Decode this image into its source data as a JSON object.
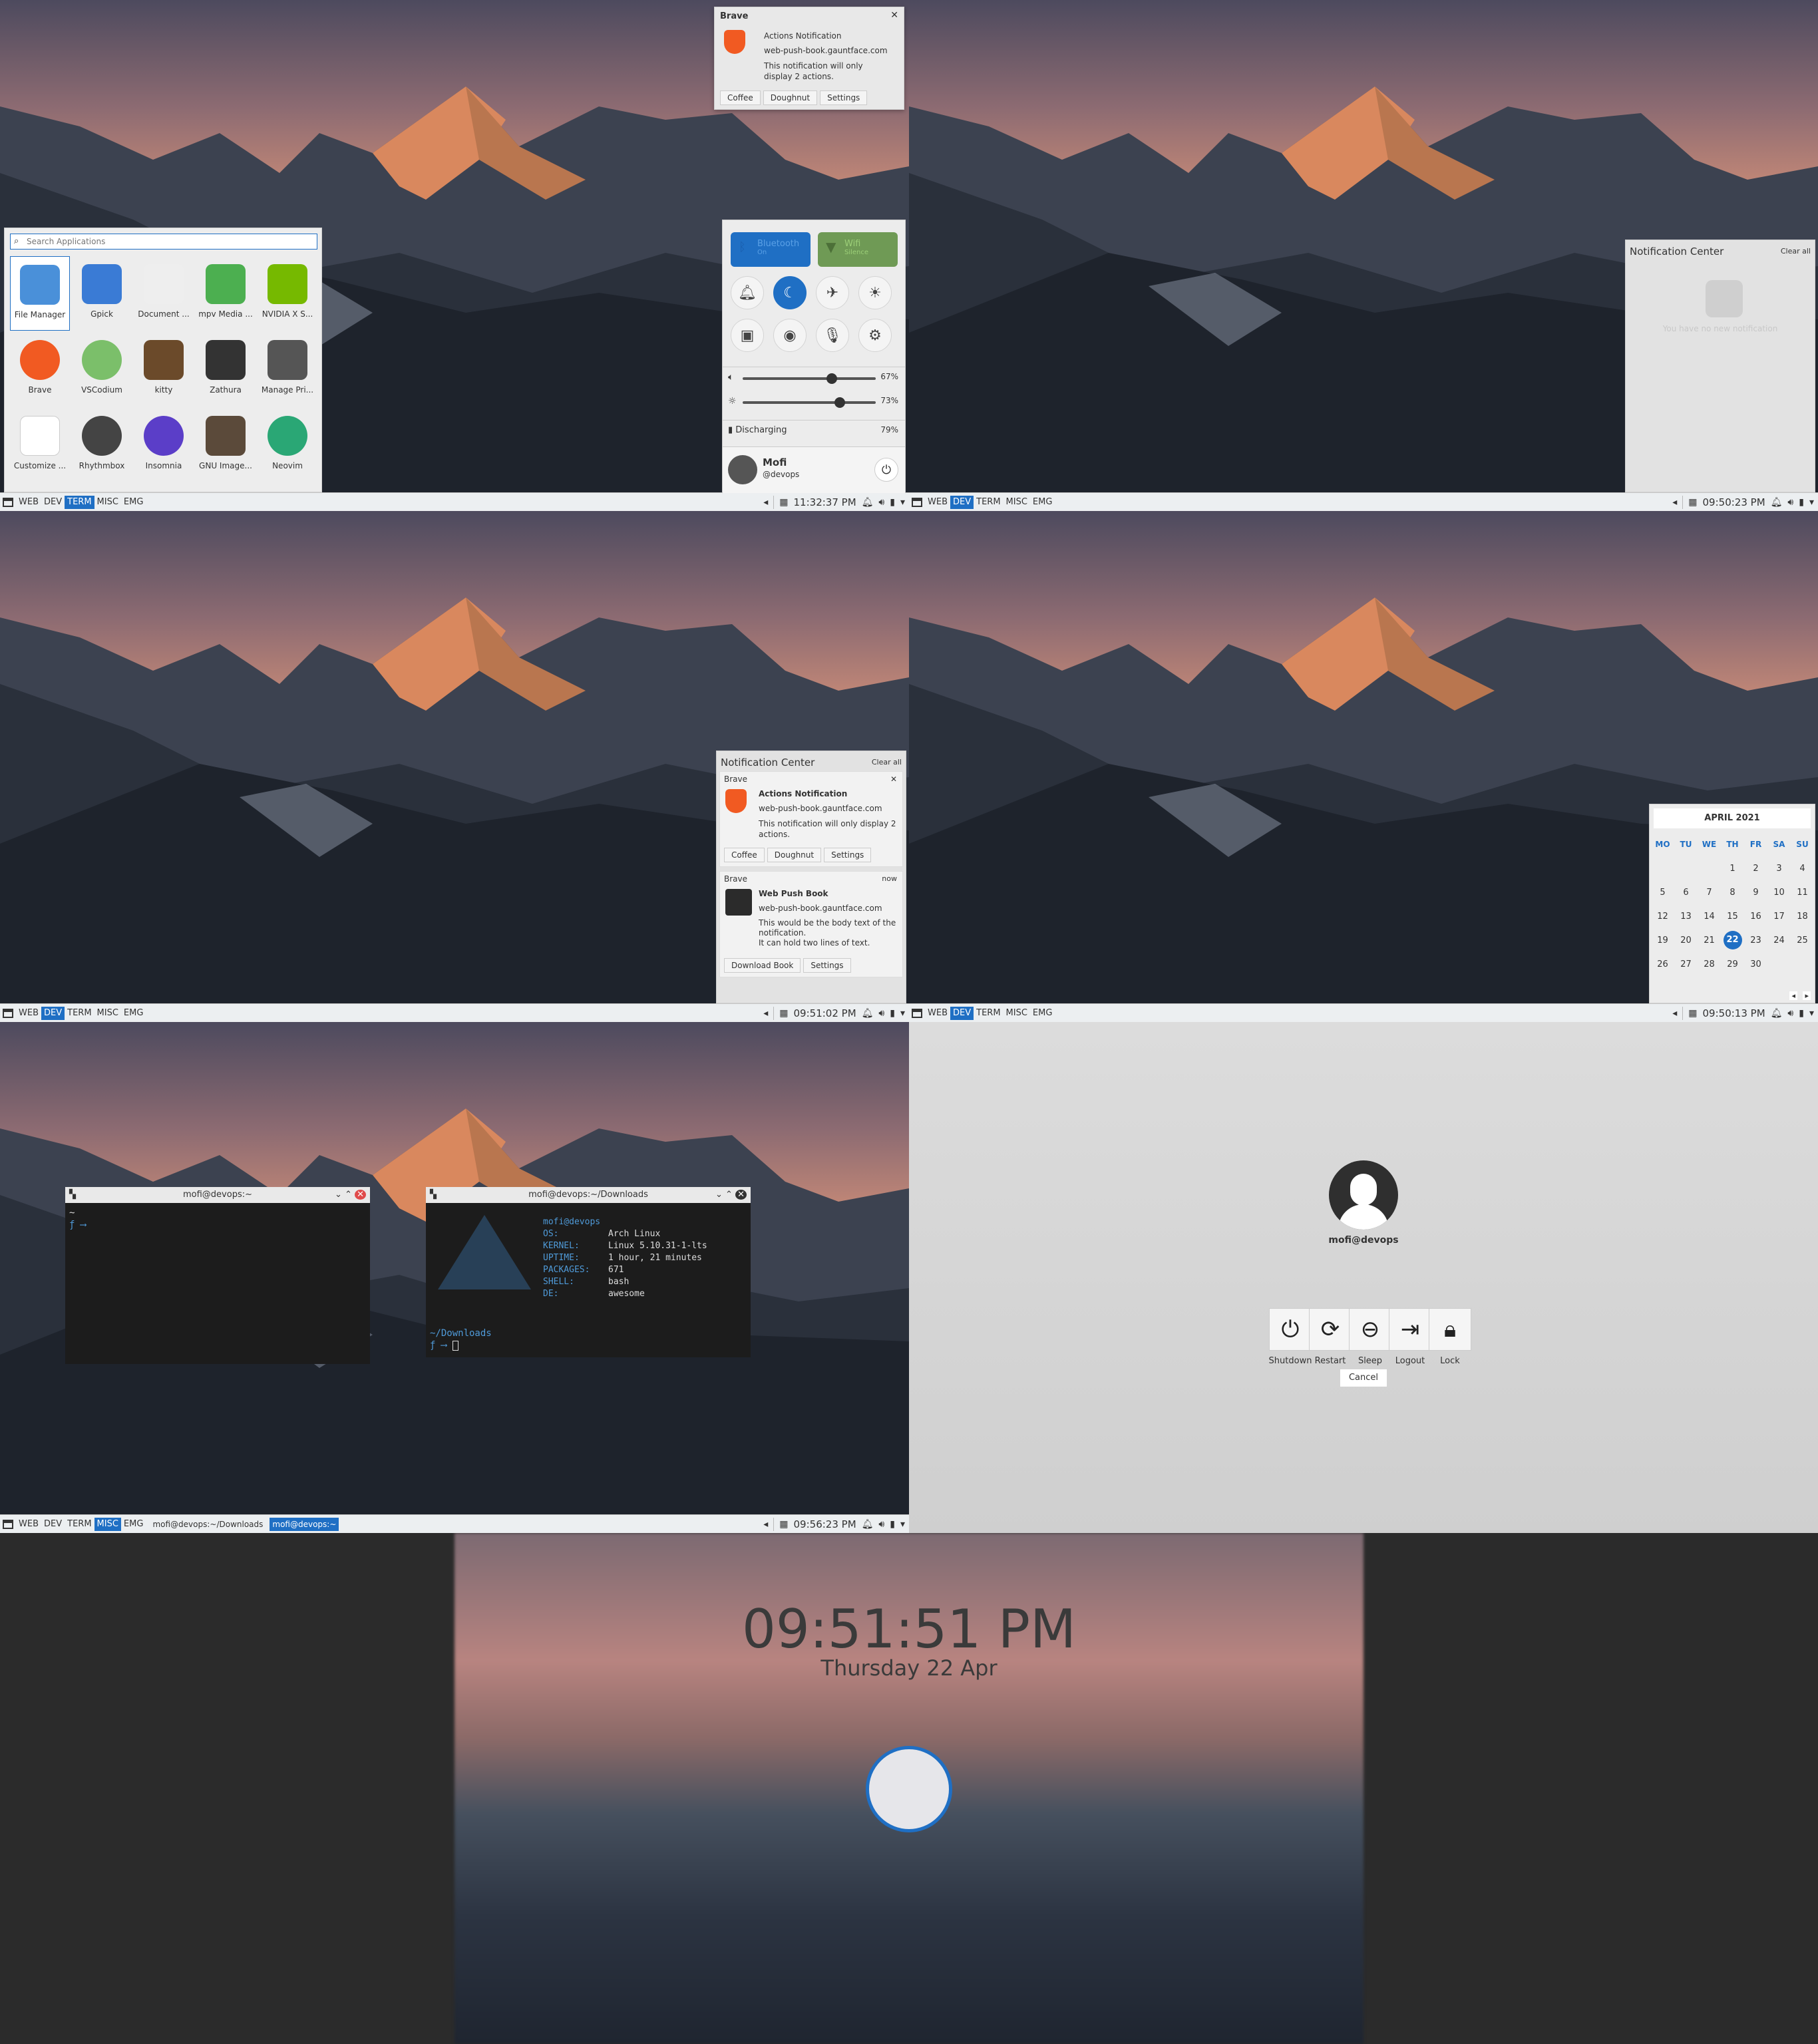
{
  "taskbar_tags": [
    "WEB",
    "DEV",
    "TERM",
    "MISC",
    "EMG"
  ],
  "panel1": {
    "clock": "11:32:37 PM",
    "notification": {
      "app": "Brave",
      "title": "Actions Notification",
      "site": "web-push-book.gauntface.com",
      "body": "This notification will only display 2 actions.",
      "actions": [
        "Coffee",
        "Doughnut",
        "Settings"
      ]
    },
    "launcher": {
      "search_placeholder": "Search Applications",
      "apps": [
        "File Manager",
        "Gpick",
        "Document ...",
        "mpv Media ...",
        "NVIDIA X S...",
        "Brave",
        "VSCodium",
        "kitty",
        "Zathura",
        "Manage Pri...",
        "Customize ...",
        "Rhythmbox",
        "Insomnia",
        "GNU Image...",
        "Neovim"
      ]
    },
    "quick": {
      "bluetooth": "Bluetooth",
      "bluetooth_sub": "On",
      "wifi": "Wifi",
      "wifi_sub": "Silence",
      "volume": "67%",
      "volume_value": 0.67,
      "brightness": "73%",
      "brightness_value": 0.73,
      "battery": "Discharging",
      "battery_pct": "79%",
      "user": "Mofi",
      "handle": "@devops"
    }
  },
  "panel2": {
    "clock": "09:50:23 PM",
    "title": "Notification Center",
    "clear": "Clear all",
    "empty": "You have no new notification"
  },
  "panel3": {
    "clock": "09:51:02 PM",
    "title": "Notification Center",
    "clear": "Clear all",
    "n1": {
      "app": "Brave",
      "title": "Actions Notification",
      "site": "web-push-book.gauntface.com",
      "body": "This notification will only display 2 actions.",
      "actions": [
        "Coffee",
        "Doughnut",
        "Settings"
      ]
    },
    "n2": {
      "app": "Brave",
      "time": "now",
      "title": "Web Push Book",
      "site": "web-push-book.gauntface.com",
      "body1": "This would be the body text of the notification.",
      "body2": "It can hold two lines of text.",
      "actions": [
        "Download Book",
        "Settings"
      ]
    }
  },
  "panel4": {
    "clock": "09:50:13 PM",
    "month": "APRIL 2021",
    "days": [
      "MO",
      "TU",
      "WE",
      "TH",
      "FR",
      "SA",
      "SU"
    ],
    "weeks": [
      [
        "",
        "",
        "",
        "1",
        "2",
        "3",
        "4"
      ],
      [
        "5",
        "6",
        "7",
        "8",
        "9",
        "10",
        "11"
      ],
      [
        "12",
        "13",
        "14",
        "15",
        "16",
        "17",
        "18"
      ],
      [
        "19",
        "20",
        "21",
        "22",
        "23",
        "24",
        "25"
      ],
      [
        "26",
        "27",
        "28",
        "29",
        "30",
        "",
        ""
      ]
    ],
    "today": "22"
  },
  "panel5": {
    "clock": "09:56:23 PM",
    "tasks": [
      "mofi@devops:~/Downloads",
      "mofi@devops:~"
    ],
    "term1": {
      "title": "mofi@devops:~",
      "line1": "~",
      "prompt": "⟶"
    },
    "term2": {
      "title": "mofi@devops:~/Downloads",
      "userhost": "mofi@devops",
      "keys": [
        "OS:",
        "KERNEL:",
        "UPTIME:",
        "PACKAGES:",
        "SHELL:",
        "DE:"
      ],
      "vals": [
        "Arch Linux",
        "Linux 5.10.31-1-lts",
        "1 hour, 21 minutes",
        "671",
        "bash",
        "awesome"
      ],
      "cwd": "~/Downloads",
      "prompt": "⟶"
    }
  },
  "panel6": {
    "user": "mofi@devops",
    "actions": [
      "Shutdown",
      "Restart",
      "Sleep",
      "Logout",
      "Lock"
    ],
    "cancel": "Cancel"
  },
  "lock": {
    "time": "09:51:51 PM",
    "date": "Thursday 22 Apr"
  }
}
